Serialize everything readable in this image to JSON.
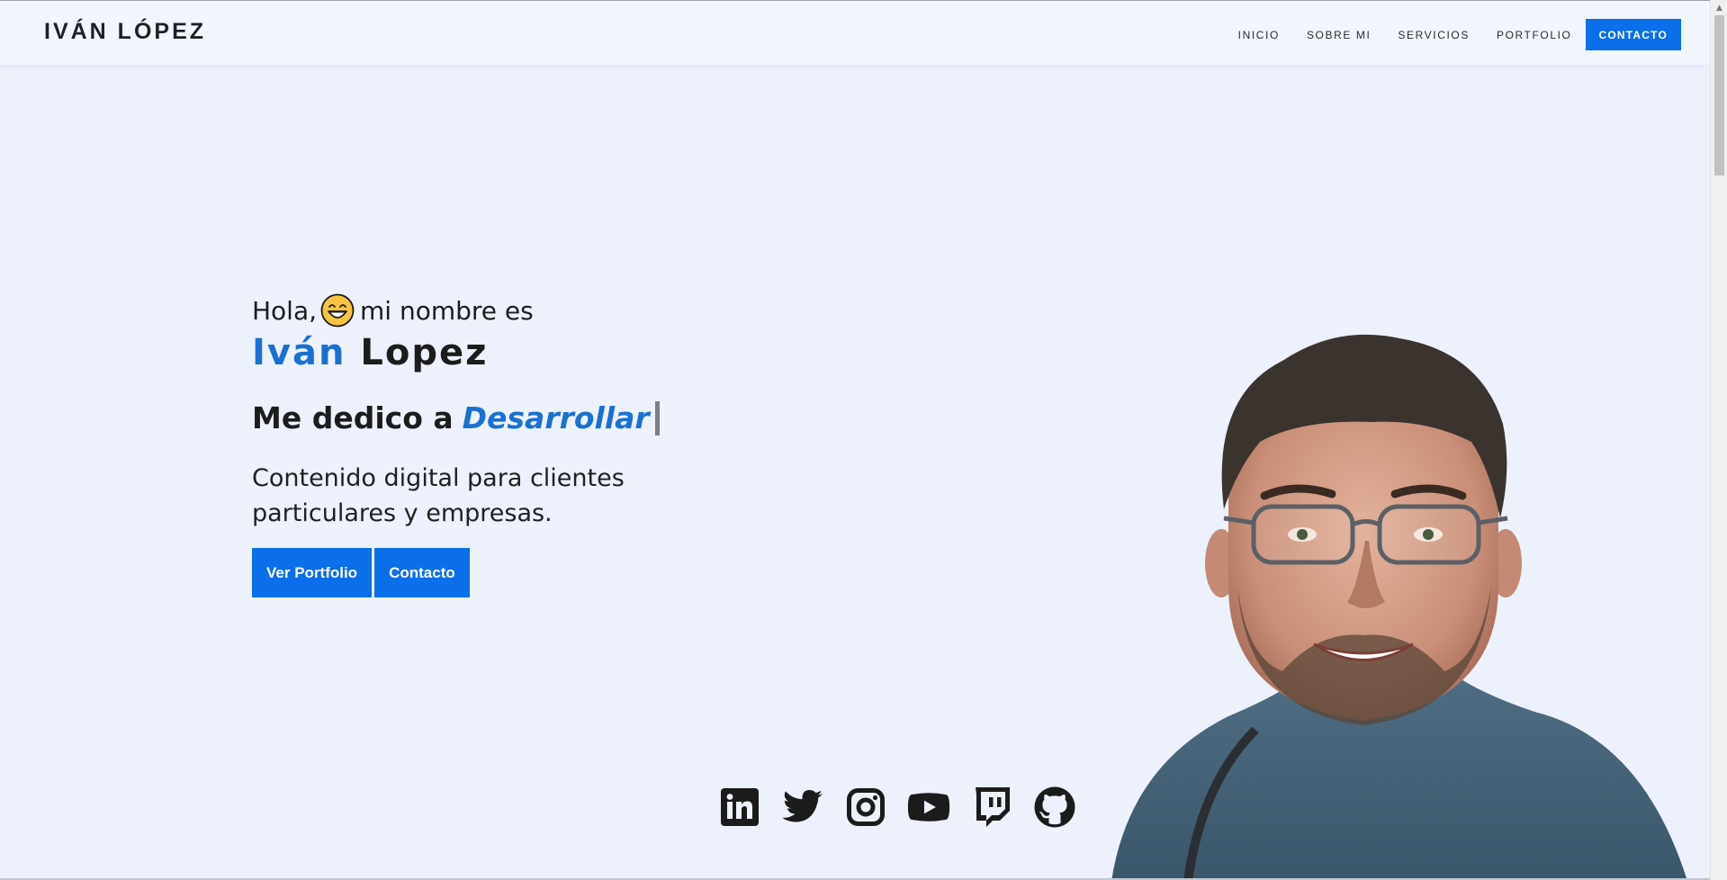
{
  "header": {
    "brand": "IVÁN LÓPEZ",
    "nav": [
      {
        "label": "INICIO"
      },
      {
        "label": "SOBRE MI"
      },
      {
        "label": "SERVICIOS"
      },
      {
        "label": "PORTFOLIO"
      }
    ],
    "cta_label": "CONTACTO"
  },
  "hero": {
    "greeting_before": "Hola,",
    "greeting_emoji": "grinning-face-emoji",
    "greeting_after": "mi nombre es",
    "first_name": "Iván",
    "last_name": "Lopez",
    "dedico_prefix": "Me dedico a",
    "dedico_word": "Desarrollar",
    "description": "Contenido digital para clientes particulares y empresas.",
    "buttons": [
      {
        "label": "Ver Portfolio"
      },
      {
        "label": "Contacto"
      }
    ]
  },
  "social": [
    "linkedin-icon",
    "twitter-icon",
    "instagram-icon",
    "youtube-icon",
    "twitch-icon",
    "github-icon"
  ],
  "colors": {
    "accent": "#0a6fe8",
    "name_blue": "#1a6fd3",
    "background": "#ecf1fc",
    "header_bg": "#f1f5fe"
  }
}
